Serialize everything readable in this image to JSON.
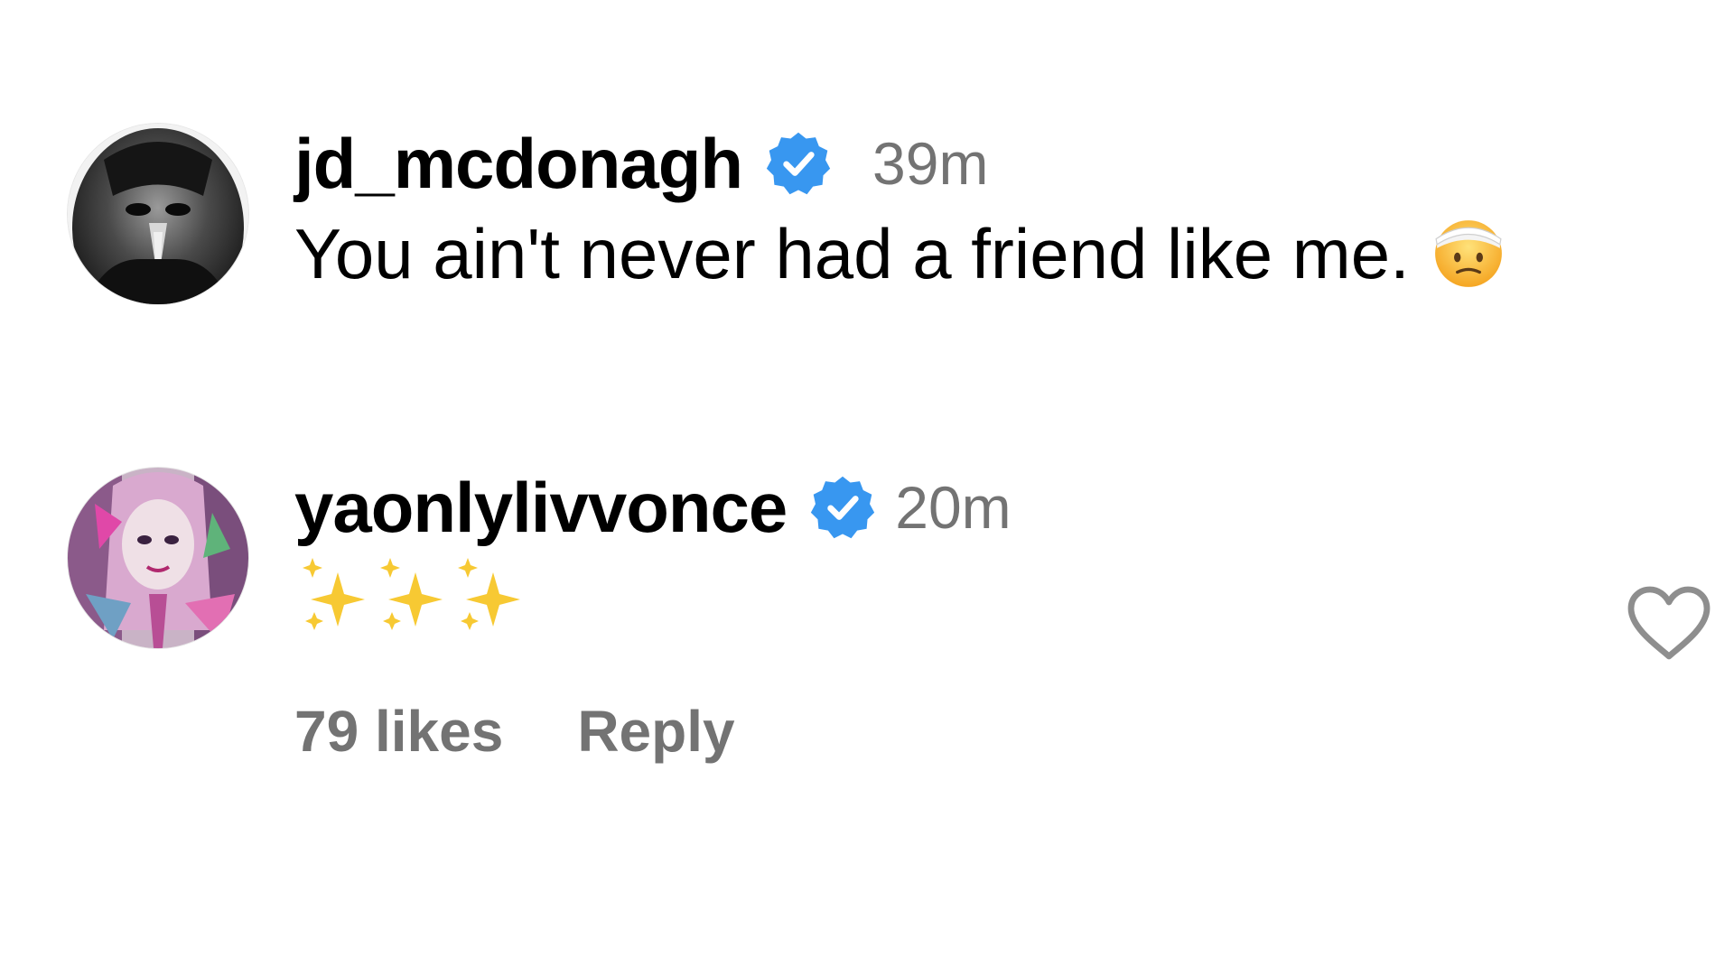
{
  "comments": [
    {
      "username": "jd_mcdonagh",
      "verified": true,
      "time": "39m",
      "text": "You ain't never had a friend like me.",
      "emoji": "face-with-head-bandage"
    },
    {
      "username": "yaonlylivvonce",
      "verified": true,
      "time": "20m",
      "text_emoji": "sparkles",
      "likes": "79 likes",
      "reply_label": "Reply"
    }
  ],
  "colors": {
    "verified_blue": "#3897f0",
    "secondary_text": "#737373",
    "text": "#000000"
  },
  "icons": [
    "verified-badge-icon",
    "heart-icon",
    "sparkles-icon",
    "bandage-face-emoji"
  ]
}
